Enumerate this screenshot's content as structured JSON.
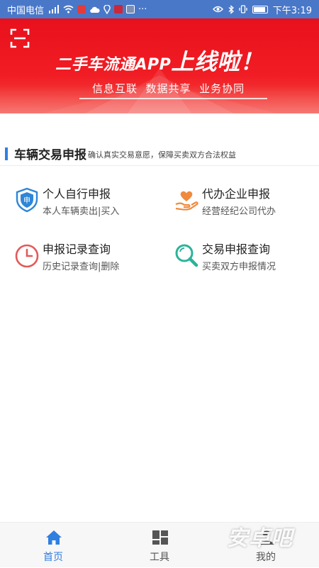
{
  "status_bar": {
    "carrier": "中国电信",
    "time": "下午3:19"
  },
  "banner": {
    "headline_prefix": "二手车流通APP",
    "headline_suffix": "上线啦！",
    "slogan": "信息互联  数据共享  业务协同"
  },
  "section": {
    "title": "车辆交易申报",
    "description": "确认真实交易意愿，保障买卖双方合法权益"
  },
  "services": [
    {
      "title": "个人自行申报",
      "subtitle": "本人车辆卖出|买入",
      "icon": "shield-icon",
      "icon_label": "申"
    },
    {
      "title": "代办企业申报",
      "subtitle": "经营经纪公司代办",
      "icon": "hand-heart-icon"
    },
    {
      "title": "申报记录查询",
      "subtitle": "历史记录查询|删除",
      "icon": "clock-icon"
    },
    {
      "title": "交易申报查询",
      "subtitle": "买卖双方申报情况",
      "icon": "magnifier-icon"
    }
  ],
  "bottom_nav": [
    {
      "label": "首页",
      "icon": "home-icon",
      "active": true
    },
    {
      "label": "工具",
      "icon": "grid-icon",
      "active": false
    },
    {
      "label": "我的",
      "icon": "user-icon",
      "active": false
    }
  ],
  "watermark": "安卓吧",
  "colors": {
    "status_bar": "#4a78c8",
    "banner_red": "#ef1c24",
    "accent_blue": "#2f7fe0",
    "nav_active": "#2f7fe0",
    "nav_inactive": "#555555"
  }
}
